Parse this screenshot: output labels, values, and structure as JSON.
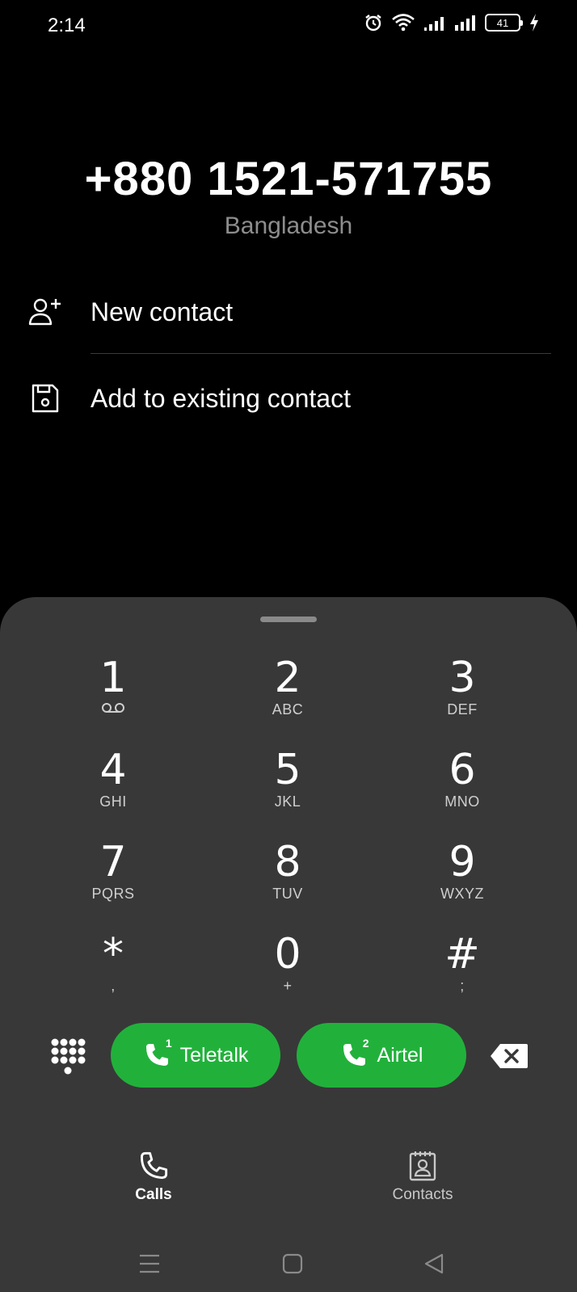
{
  "status_bar": {
    "time": "2:14",
    "battery_level": "41",
    "icons": [
      "alarm-icon",
      "wifi-icon",
      "signal-sim1-icon",
      "signal-sim2-icon",
      "battery-icon",
      "charging-icon"
    ]
  },
  "dialer": {
    "number": "+880 1521-571755",
    "region": "Bangladesh"
  },
  "actions": {
    "new_contact": "New contact",
    "add_existing": "Add to existing contact"
  },
  "keypad": [
    {
      "digit": "1",
      "letters": ""
    },
    {
      "digit": "2",
      "letters": "ABC"
    },
    {
      "digit": "3",
      "letters": "DEF"
    },
    {
      "digit": "4",
      "letters": "GHI"
    },
    {
      "digit": "5",
      "letters": "JKL"
    },
    {
      "digit": "6",
      "letters": "MNO"
    },
    {
      "digit": "7",
      "letters": "PQRS"
    },
    {
      "digit": "8",
      "letters": "TUV"
    },
    {
      "digit": "9",
      "letters": "WXYZ"
    },
    {
      "digit": "*",
      "letters": ","
    },
    {
      "digit": "0",
      "letters": "+"
    },
    {
      "digit": "#",
      "letters": ";"
    }
  ],
  "call_buttons": {
    "sim1": {
      "number": "1",
      "label": "Teletalk"
    },
    "sim2": {
      "number": "2",
      "label": "Airtel"
    }
  },
  "tabs": {
    "calls": "Calls",
    "contacts": "Contacts"
  },
  "colors": {
    "background": "#000000",
    "sheet": "#383838",
    "call_green": "#21b13b",
    "region_gray": "#8d8d8d",
    "inactive_tab": "#c8c8c8"
  }
}
